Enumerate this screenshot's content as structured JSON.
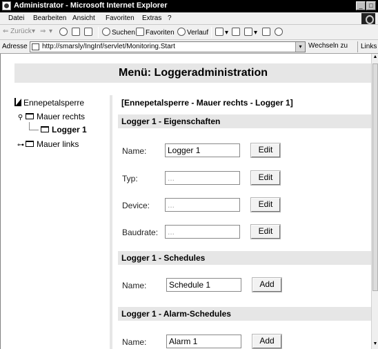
{
  "window": {
    "title": "Administrator - Microsoft Internet Explorer",
    "min_glyph": "_",
    "max_glyph": "□"
  },
  "menubar": {
    "items": [
      "Datei",
      "Bearbeiten",
      "Ansicht",
      "Favoriten",
      "Extras",
      "?"
    ]
  },
  "toolbar": {
    "back": "⇐ Zurück",
    "back_drop": "▾",
    "forward": "⇒",
    "forward_drop": "▾",
    "search": "Suchen",
    "favorites": "Favoriten",
    "history": "Verlauf",
    "mail_drop": "▾",
    "edit_drop": "▾"
  },
  "address": {
    "label": "Adresse",
    "url": "http://smarsly/IngInf/servlet/Monitoring.Start",
    "drop": "▾",
    "go": "Wechseln zu",
    "links": "Links"
  },
  "page": {
    "title": "Menü:  Loggeradministration",
    "breadcrumb": "[Ennepetalsperre - Mauer rechts - Logger 1]"
  },
  "tree": {
    "root": "Ennepetalsperre",
    "node1_toggle": "⚲",
    "node1": "Mauer rechts",
    "node1_child": "Logger 1",
    "node2_toggle": "⊶",
    "node2": "Mauer links"
  },
  "sections": {
    "properties": {
      "title": "Logger 1 - Eigenschaften",
      "name_label": "Name:",
      "name_value": "Logger 1",
      "type_label": "Typ:",
      "type_placeholder": "...",
      "device_label": "Device:",
      "device_placeholder": "...",
      "baud_label": "Baudrate:",
      "baud_placeholder": "...",
      "edit_label": "Edit"
    },
    "schedules": {
      "title": "Logger 1 - Schedules",
      "name_label": "Name:",
      "name_value": "Schedule 1",
      "add_label": "Add"
    },
    "alarm": {
      "title": "Logger 1 - Alarm-Schedules",
      "name_label": "Name:",
      "name_value": "Alarm 1",
      "add_label": "Add"
    }
  },
  "scrollbar": {
    "up": "▲",
    "down": "▼"
  }
}
